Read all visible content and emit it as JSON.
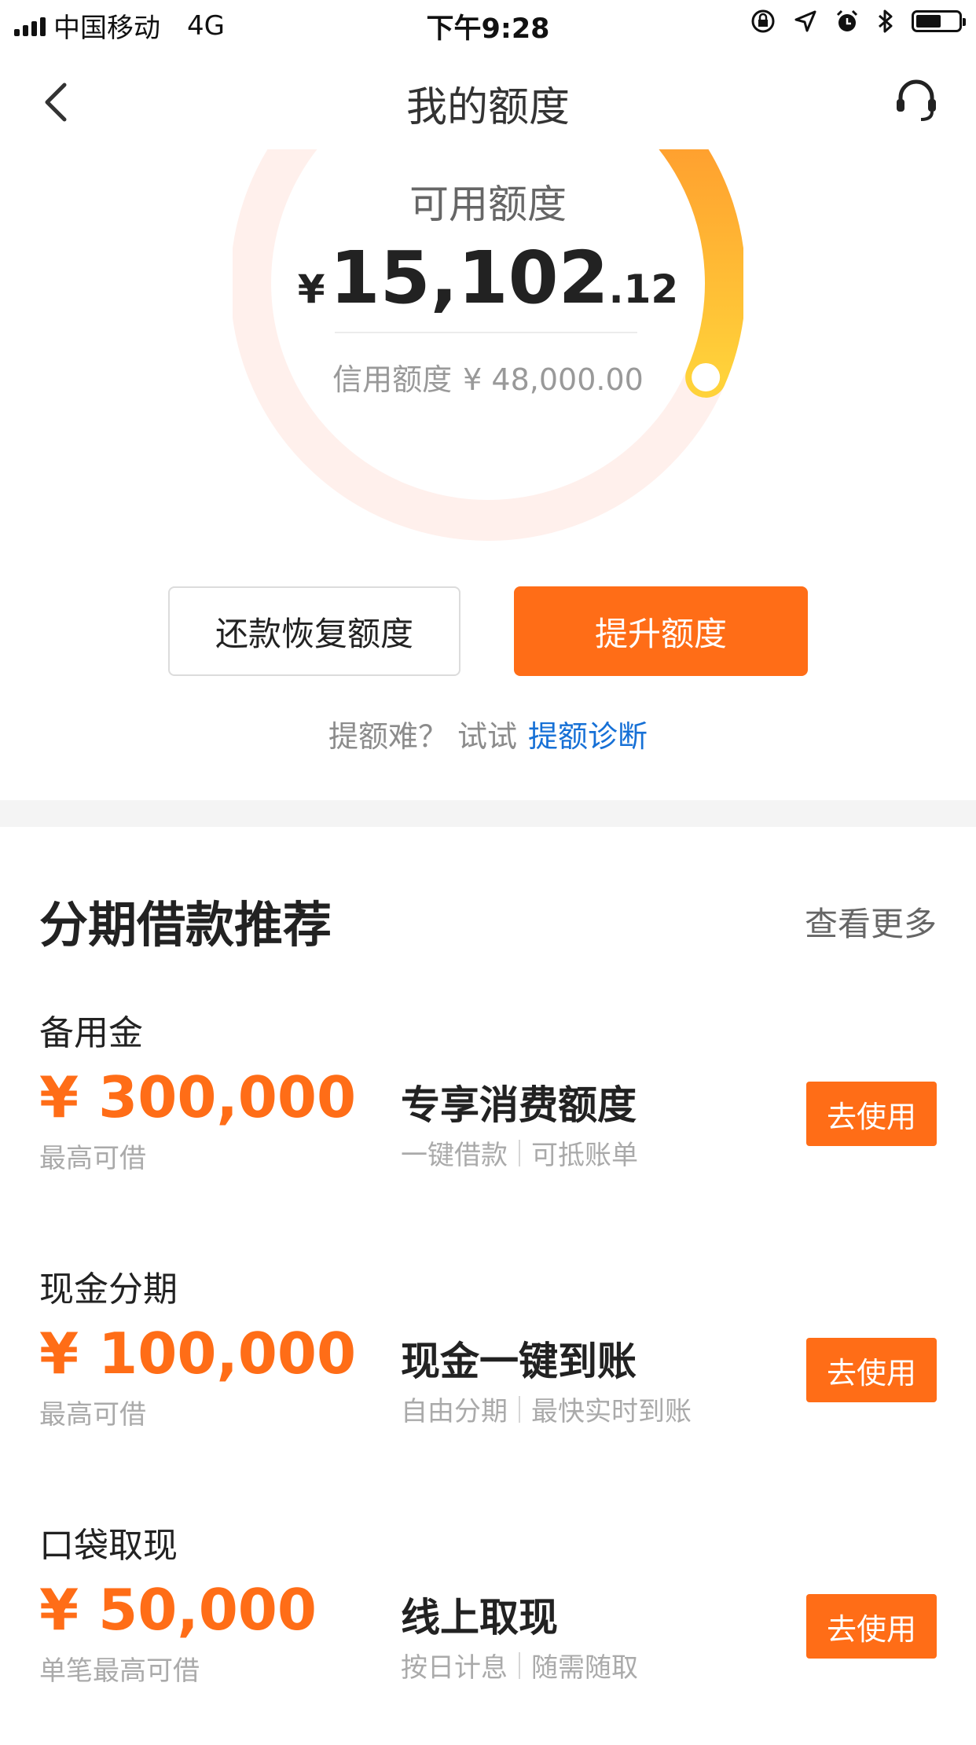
{
  "status_bar": {
    "carrier": "中国移动",
    "network": "4G",
    "time": "下午9:28",
    "icons": [
      "signal-icon",
      "rotation-lock-icon",
      "location-icon",
      "alarm-icon",
      "bluetooth-icon",
      "battery-icon"
    ],
    "battery_level": 0.6
  },
  "nav": {
    "title": "我的额度",
    "back_icon": "chevron-left-icon",
    "service_icon": "headset-icon"
  },
  "gauge": {
    "label": "可用额度",
    "currency": "¥",
    "amount_int": "15,102",
    "amount_dec": ".12",
    "credit_label": "信用额度",
    "credit_value": "¥ 48,000.00",
    "used_fraction": 0.315,
    "colors": {
      "track": "#fff0ec",
      "arc_start": "#ff8a2a",
      "arc_end": "#ffd23a"
    }
  },
  "actions": {
    "repay_label": "还款恢复额度",
    "raise_label": "提升额度"
  },
  "hint": {
    "text": "提额难？ 试试",
    "link": "提额诊断"
  },
  "section": {
    "title": "分期借款推荐",
    "more": "查看更多",
    "items": [
      {
        "name": "备用金",
        "amount": "¥ 300,000",
        "sub": "最高可借",
        "product": "专享消费额度",
        "tag1": "一键借款",
        "tag2": "可抵账单",
        "button": "去使用"
      },
      {
        "name": "现金分期",
        "amount": "¥ 100,000",
        "sub": "最高可借",
        "product": "现金一键到账",
        "tag1": "自由分期",
        "tag2": "最快实时到账",
        "button": "去使用"
      },
      {
        "name": "口袋取现",
        "amount": "¥ 50,000",
        "sub": "单笔最高可借",
        "product": "线上取现",
        "tag1": "按日计息",
        "tag2": "随需随取",
        "button": "去使用"
      }
    ]
  },
  "colors": {
    "accent": "#ff6d17",
    "link": "#1670d6"
  }
}
